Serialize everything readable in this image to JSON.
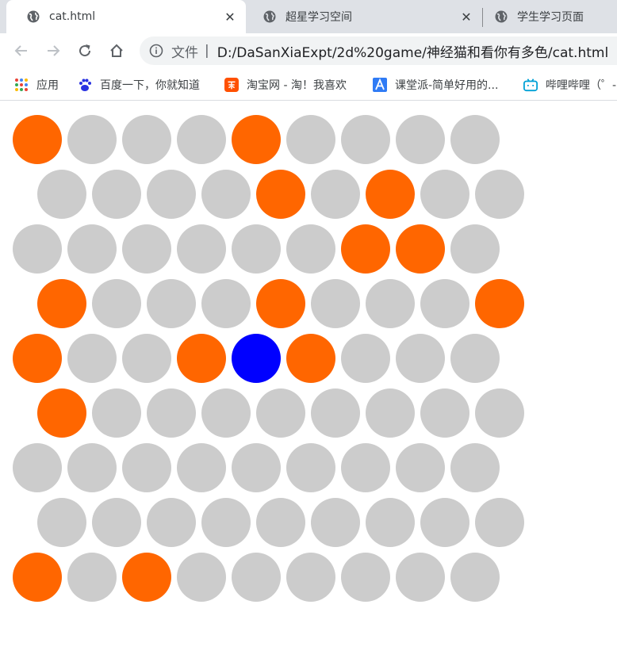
{
  "browser": {
    "tabs": [
      {
        "title": "cat.html",
        "active": true
      },
      {
        "title": "超星学习空间",
        "active": false
      },
      {
        "title": "学生学习页面",
        "active": false
      }
    ],
    "tab_close_glyph": "✕",
    "address": {
      "secure_label": "文件",
      "separator": "|",
      "url": "D:/DaSanXiaExpt/2d%20game/神经猫和看你有多色/cat.html"
    },
    "bookmarks": [
      {
        "label": "应用",
        "icon": "apps-grid-icon"
      },
      {
        "label": "百度一下，你就知道",
        "icon": "baidu-paw-icon"
      },
      {
        "label": "淘宝网 - 淘！我喜欢",
        "icon": "taobao-icon"
      },
      {
        "label": "课堂派-简单好用的...",
        "icon": "ketangpai-icon"
      },
      {
        "label": "哔哩哔哩（゜-",
        "icon": "bilibili-icon"
      }
    ]
  },
  "game": {
    "colors": {
      "empty": "#cccccc",
      "blocked": "#ff6600",
      "cat": "#0000ff"
    },
    "grid": [
      [
        "blocked",
        "empty",
        "empty",
        "empty",
        "blocked",
        "empty",
        "empty",
        "empty",
        "empty"
      ],
      [
        "empty",
        "empty",
        "empty",
        "empty",
        "blocked",
        "empty",
        "blocked",
        "empty",
        "empty"
      ],
      [
        "empty",
        "empty",
        "empty",
        "empty",
        "empty",
        "empty",
        "blocked",
        "blocked",
        "empty"
      ],
      [
        "blocked",
        "empty",
        "empty",
        "empty",
        "blocked",
        "empty",
        "empty",
        "empty",
        "blocked"
      ],
      [
        "blocked",
        "empty",
        "empty",
        "blocked",
        "cat",
        "blocked",
        "empty",
        "empty",
        "empty"
      ],
      [
        "blocked",
        "empty",
        "empty",
        "empty",
        "empty",
        "empty",
        "empty",
        "empty",
        "empty"
      ],
      [
        "empty",
        "empty",
        "empty",
        "empty",
        "empty",
        "empty",
        "empty",
        "empty",
        "empty"
      ],
      [
        "empty",
        "empty",
        "empty",
        "empty",
        "empty",
        "empty",
        "empty",
        "empty",
        "empty"
      ],
      [
        "blocked",
        "empty",
        "blocked",
        "empty",
        "empty",
        "empty",
        "empty",
        "empty",
        "empty"
      ]
    ]
  }
}
